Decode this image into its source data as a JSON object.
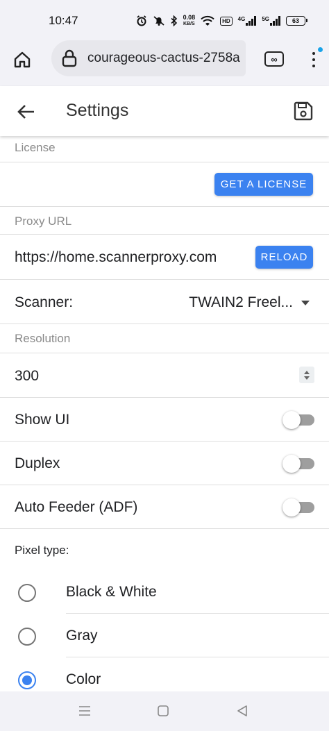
{
  "status_bar": {
    "time": "10:47",
    "speed_value": "0.08",
    "speed_unit": "KB/S",
    "hd_label": "HD",
    "net1_label": "4G",
    "net2_label": "5G",
    "battery_level": "63"
  },
  "browser": {
    "url": "courageous-cactus-2758a",
    "tabs_icon": "infinity-tabs-icon",
    "notification_color": "#1aa3e8"
  },
  "header": {
    "title": "Settings"
  },
  "license": {
    "section_label": "License",
    "button_label": "GET A LICENSE"
  },
  "proxy": {
    "section_label": "Proxy URL",
    "value": "https://home.scannerproxy.com",
    "button_label": "RELOAD"
  },
  "scanner": {
    "label": "Scanner:",
    "selected": "TWAIN2 Freel..."
  },
  "resolution": {
    "section_label": "Resolution",
    "value": "300"
  },
  "toggles": [
    {
      "label": "Show UI",
      "on": false
    },
    {
      "label": "Duplex",
      "on": false
    },
    {
      "label": "Auto Feeder (ADF)",
      "on": false
    }
  ],
  "pixel_type": {
    "label": "Pixel type:",
    "options": [
      {
        "label": "Black & White",
        "checked": false
      },
      {
        "label": "Gray",
        "checked": false
      },
      {
        "label": "Color",
        "checked": true
      }
    ]
  },
  "colors": {
    "accent": "#3b82f0",
    "toggle_track": "#9e9e9e"
  }
}
